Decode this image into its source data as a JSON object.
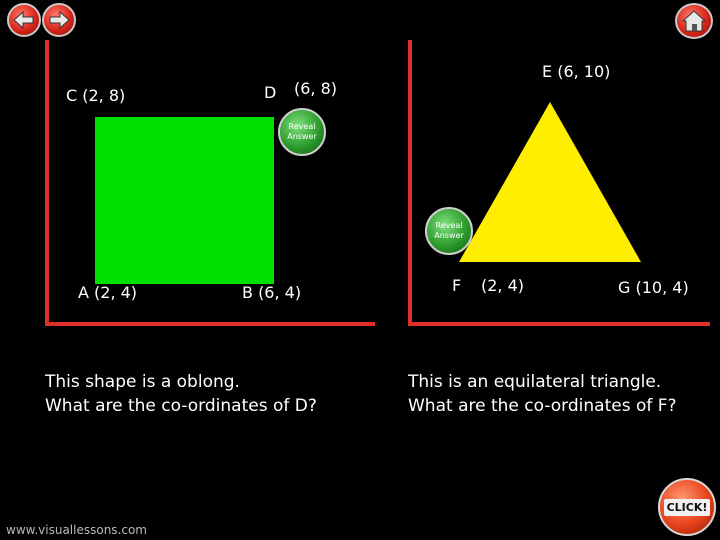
{
  "nav": {
    "back_icon": "arrow-left-icon",
    "forward_icon": "arrow-right-icon",
    "home_icon": "home-icon"
  },
  "left_panel": {
    "labels": {
      "c": "C (2, 8)",
      "d": "D",
      "d_answer": "(6, 8)",
      "a": "A (2, 4)",
      "b": "B (6, 4)"
    },
    "reveal_line1": "Reveal",
    "reveal_line2": "Answer",
    "question_line1": "This shape is a oblong.",
    "question_line2": "What are the co-ordinates of D?"
  },
  "right_panel": {
    "labels": {
      "e": "E (6, 10)",
      "f": "F",
      "f_answer": "(2, 4)",
      "g": "G (10, 4)"
    },
    "reveal_line1": "Reveal",
    "reveal_line2": "Answer",
    "question_line1": "This is an equilateral triangle.",
    "question_line2": "What are the co-ordinates of F?"
  },
  "footer": {
    "credit": "www.visuallessons.com",
    "click_label": "CLICK!"
  },
  "colors": {
    "background": "#000000",
    "axis": "#e0302a",
    "square": "#00e000",
    "triangle": "#ffee00"
  }
}
